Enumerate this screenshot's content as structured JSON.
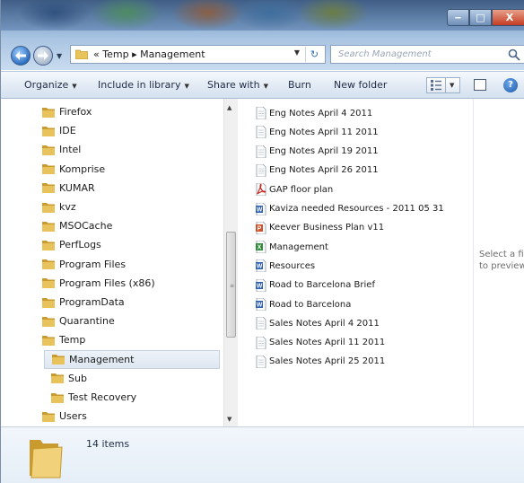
{
  "window": {
    "controls": {
      "minimize": "‒",
      "maximize": "□",
      "close": "X"
    }
  },
  "address": {
    "prefix": "«",
    "path": [
      "Temp",
      "Management"
    ],
    "separator": "▸",
    "search_placeholder": "Search Management"
  },
  "toolbar": {
    "organize": "Organize",
    "include_in_library": "Include in library",
    "share_with": "Share with",
    "burn": "Burn",
    "new_folder": "New folder",
    "help": "?"
  },
  "nav_tree": [
    {
      "label": "Firefox",
      "indent": 0
    },
    {
      "label": "IDE",
      "indent": 0
    },
    {
      "label": "Intel",
      "indent": 0
    },
    {
      "label": "Komprise",
      "indent": 0
    },
    {
      "label": "KUMAR",
      "indent": 0
    },
    {
      "label": "kvz",
      "indent": 0
    },
    {
      "label": "MSOCache",
      "indent": 0
    },
    {
      "label": "PerfLogs",
      "indent": 0
    },
    {
      "label": "Program Files",
      "indent": 0
    },
    {
      "label": "Program Files (x86)",
      "indent": 0
    },
    {
      "label": "ProgramData",
      "indent": 0
    },
    {
      "label": "Quarantine",
      "indent": 0
    },
    {
      "label": "Temp",
      "indent": 0
    },
    {
      "label": "Management",
      "indent": 1,
      "selected": true
    },
    {
      "label": "Sub",
      "indent": 1
    },
    {
      "label": "Test Recovery",
      "indent": 1
    },
    {
      "label": "Users",
      "indent": 0
    }
  ],
  "files": [
    {
      "name": "Eng Notes April 4 2011",
      "type": "text"
    },
    {
      "name": "Eng Notes April 11 2011",
      "type": "text"
    },
    {
      "name": "Eng Notes April 19 2011",
      "type": "text"
    },
    {
      "name": "Eng Notes April 26 2011",
      "type": "text"
    },
    {
      "name": "GAP floor plan",
      "type": "pdf"
    },
    {
      "name": "Kaviza needed Resources - 2011 05 31",
      "type": "word"
    },
    {
      "name": "Keever Business Plan v11",
      "type": "powerpoint"
    },
    {
      "name": "Management",
      "type": "excel"
    },
    {
      "name": "Resources",
      "type": "word"
    },
    {
      "name": "Road to Barcelona Brief",
      "type": "word"
    },
    {
      "name": "Road to Barcelona",
      "type": "word"
    },
    {
      "name": "Sales Notes April 4 2011",
      "type": "text"
    },
    {
      "name": "Sales Notes April 11 2011",
      "type": "text"
    },
    {
      "name": "Sales Notes April 25 2011",
      "type": "text"
    }
  ],
  "preview": {
    "line1": "Select a file",
    "line2": "to preview."
  },
  "details": {
    "item_count": "14 items"
  },
  "colors": {
    "folder": "#e8c25a",
    "folder_dark": "#c99a2e",
    "pdf": "#c8281e",
    "word": "#2b5fb3",
    "excel": "#2f8a3a",
    "powerpoint": "#d0502a"
  }
}
